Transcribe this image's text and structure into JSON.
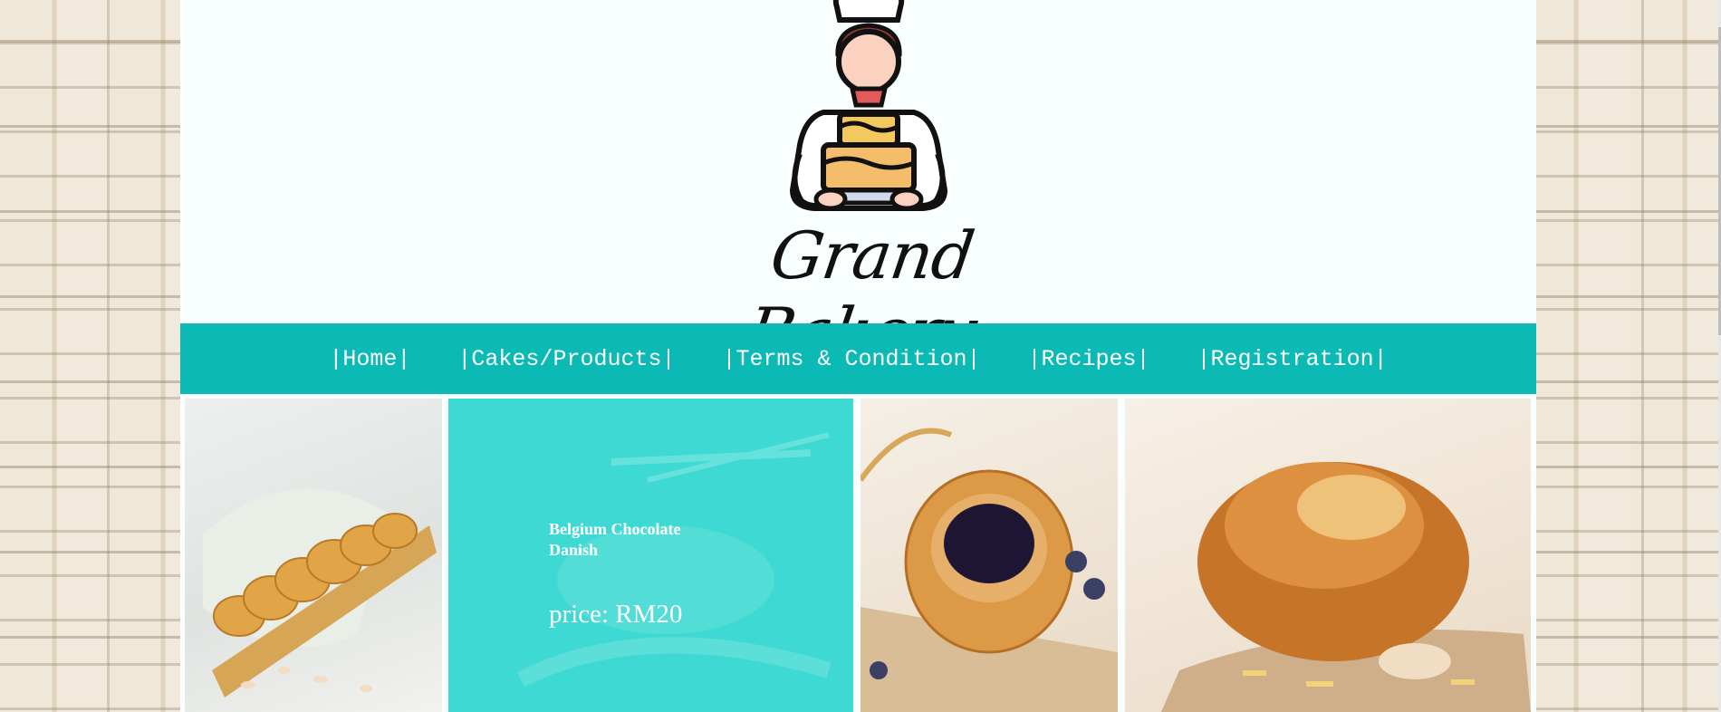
{
  "brand": {
    "name": "Grand Bakery"
  },
  "nav": {
    "items": [
      {
        "label": "|Home|"
      },
      {
        "label": "|Cakes/Products|"
      },
      {
        "label": "|Terms & Condition|"
      },
      {
        "label": "|Recipes|"
      },
      {
        "label": "|Registration|"
      }
    ]
  },
  "products": {
    "featured": {
      "name": "Belgium Chocolate Danish",
      "price": "price: RM20"
    }
  },
  "colors": {
    "nav_background": "#0bbab5",
    "overlay": "#3fd9d3",
    "page_background": "#f9ffff"
  },
  "icons": {
    "logo": "chef-holding-cake-icon"
  }
}
